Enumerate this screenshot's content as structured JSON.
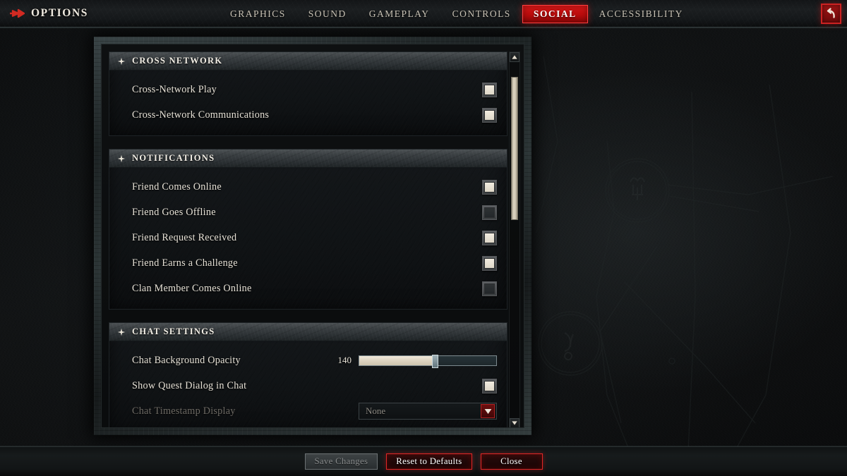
{
  "window": {
    "title": "OPTIONS",
    "back_icon": "back-arrow-icon",
    "brand_icon": "options-arrow-icon"
  },
  "nav": {
    "tabs": [
      {
        "label": "GRAPHICS",
        "active": false
      },
      {
        "label": "SOUND",
        "active": false
      },
      {
        "label": "GAMEPLAY",
        "active": false
      },
      {
        "label": "CONTROLS",
        "active": false
      },
      {
        "label": "SOCIAL",
        "active": true
      },
      {
        "label": "ACCESSIBILITY",
        "active": false
      }
    ],
    "active_tab": "SOCIAL",
    "active_color": "#c41212"
  },
  "sections": [
    {
      "title": "CROSS NETWORK",
      "glyph": "four-point-star-icon",
      "rows": [
        {
          "label": "Cross-Network Play",
          "type": "checkbox",
          "value": "on",
          "disabled": false
        },
        {
          "label": "Cross-Network Communications",
          "type": "checkbox",
          "value": "on",
          "disabled": false
        }
      ]
    },
    {
      "title": "NOTIFICATIONS",
      "glyph": "four-point-star-icon",
      "rows": [
        {
          "label": "Friend Comes Online",
          "type": "checkbox",
          "value": "on",
          "disabled": false
        },
        {
          "label": "Friend Goes Offline",
          "type": "checkbox",
          "value": "off",
          "disabled": false
        },
        {
          "label": "Friend Request Received",
          "type": "checkbox",
          "value": "on",
          "disabled": false
        },
        {
          "label": "Friend Earns a Challenge",
          "type": "checkbox",
          "value": "on",
          "disabled": false
        },
        {
          "label": "Clan Member Comes Online",
          "type": "checkbox",
          "value": "off",
          "disabled": false
        }
      ]
    },
    {
      "title": "CHAT SETTINGS",
      "glyph": "four-point-star-icon",
      "rows": [
        {
          "label": "Chat Background Opacity",
          "type": "slider",
          "value": "140",
          "percent": 55,
          "disabled": false
        },
        {
          "label": "Show Quest Dialog in Chat",
          "type": "checkbox",
          "value": "on",
          "disabled": false
        },
        {
          "label": "Chat Timestamp Display",
          "type": "dropdown",
          "value": "None",
          "disabled": true
        }
      ]
    }
  ],
  "scrollbar": {
    "up_icon": "triangle-up-icon",
    "down_icon": "triangle-down-icon",
    "thumb_top_percent": 4,
    "thumb_height_percent": 38
  },
  "footer": {
    "buttons": [
      {
        "label": "Save Changes",
        "state": "disabled"
      },
      {
        "label": "Reset to Defaults",
        "state": "danger"
      },
      {
        "label": "Close",
        "state": "danger"
      }
    ]
  }
}
